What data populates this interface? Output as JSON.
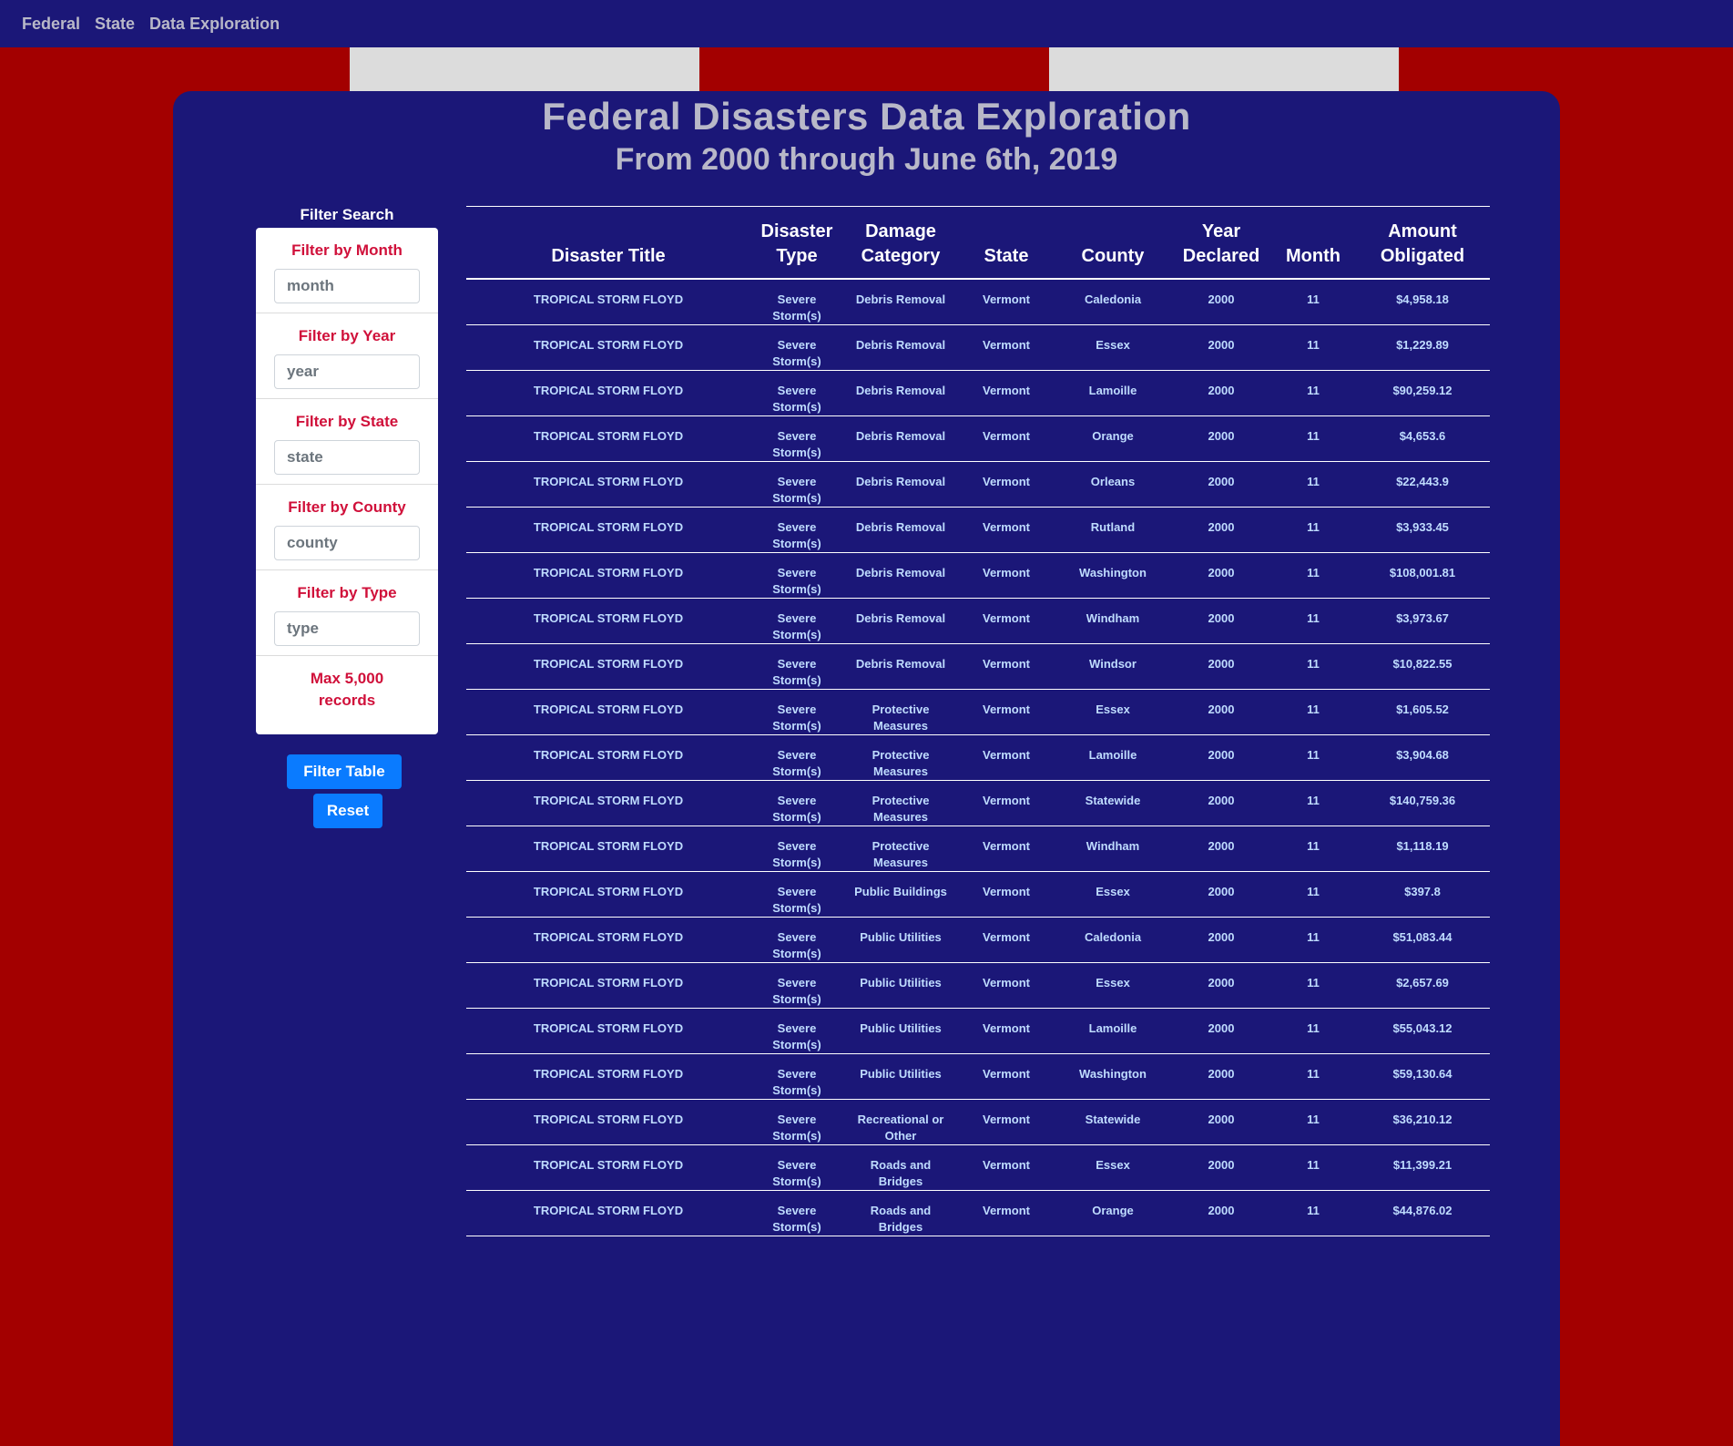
{
  "nav": {
    "links": [
      "Federal",
      "State",
      "Data Exploration"
    ]
  },
  "header": {
    "title": "Federal Disasters Data Exploration",
    "subtitle": "From 2000 through June 6th, 2019"
  },
  "filters": {
    "heading": "Filter Search",
    "month": {
      "label": "Filter by Month",
      "placeholder": "month",
      "value": ""
    },
    "year": {
      "label": "Filter by Year",
      "placeholder": "year",
      "value": ""
    },
    "state": {
      "label": "Filter by State",
      "placeholder": "state",
      "value": ""
    },
    "county": {
      "label": "Filter by County",
      "placeholder": "county",
      "value": ""
    },
    "type": {
      "label": "Filter by Type",
      "placeholder": "type",
      "value": ""
    },
    "note": "Max 5,000 records",
    "filter_button": "Filter Table",
    "reset_button": "Reset"
  },
  "table": {
    "columns": [
      "Disaster Title",
      "Disaster Type",
      "Damage Category",
      "State",
      "County",
      "Year Declared",
      "Month",
      "Amount Obligated"
    ],
    "rows": [
      [
        "TROPICAL STORM FLOYD",
        "Severe Storm(s)",
        "Debris Removal",
        "Vermont",
        "Caledonia",
        "2000",
        "11",
        "$4,958.18"
      ],
      [
        "TROPICAL STORM FLOYD",
        "Severe Storm(s)",
        "Debris Removal",
        "Vermont",
        "Essex",
        "2000",
        "11",
        "$1,229.89"
      ],
      [
        "TROPICAL STORM FLOYD",
        "Severe Storm(s)",
        "Debris Removal",
        "Vermont",
        "Lamoille",
        "2000",
        "11",
        "$90,259.12"
      ],
      [
        "TROPICAL STORM FLOYD",
        "Severe Storm(s)",
        "Debris Removal",
        "Vermont",
        "Orange",
        "2000",
        "11",
        "$4,653.6"
      ],
      [
        "TROPICAL STORM FLOYD",
        "Severe Storm(s)",
        "Debris Removal",
        "Vermont",
        "Orleans",
        "2000",
        "11",
        "$22,443.9"
      ],
      [
        "TROPICAL STORM FLOYD",
        "Severe Storm(s)",
        "Debris Removal",
        "Vermont",
        "Rutland",
        "2000",
        "11",
        "$3,933.45"
      ],
      [
        "TROPICAL STORM FLOYD",
        "Severe Storm(s)",
        "Debris Removal",
        "Vermont",
        "Washington",
        "2000",
        "11",
        "$108,001.81"
      ],
      [
        "TROPICAL STORM FLOYD",
        "Severe Storm(s)",
        "Debris Removal",
        "Vermont",
        "Windham",
        "2000",
        "11",
        "$3,973.67"
      ],
      [
        "TROPICAL STORM FLOYD",
        "Severe Storm(s)",
        "Debris Removal",
        "Vermont",
        "Windsor",
        "2000",
        "11",
        "$10,822.55"
      ],
      [
        "TROPICAL STORM FLOYD",
        "Severe Storm(s)",
        "Protective Measures",
        "Vermont",
        "Essex",
        "2000",
        "11",
        "$1,605.52"
      ],
      [
        "TROPICAL STORM FLOYD",
        "Severe Storm(s)",
        "Protective Measures",
        "Vermont",
        "Lamoille",
        "2000",
        "11",
        "$3,904.68"
      ],
      [
        "TROPICAL STORM FLOYD",
        "Severe Storm(s)",
        "Protective Measures",
        "Vermont",
        "Statewide",
        "2000",
        "11",
        "$140,759.36"
      ],
      [
        "TROPICAL STORM FLOYD",
        "Severe Storm(s)",
        "Protective Measures",
        "Vermont",
        "Windham",
        "2000",
        "11",
        "$1,118.19"
      ],
      [
        "TROPICAL STORM FLOYD",
        "Severe Storm(s)",
        "Public Buildings",
        "Vermont",
        "Essex",
        "2000",
        "11",
        "$397.8"
      ],
      [
        "TROPICAL STORM FLOYD",
        "Severe Storm(s)",
        "Public Utilities",
        "Vermont",
        "Caledonia",
        "2000",
        "11",
        "$51,083.44"
      ],
      [
        "TROPICAL STORM FLOYD",
        "Severe Storm(s)",
        "Public Utilities",
        "Vermont",
        "Essex",
        "2000",
        "11",
        "$2,657.69"
      ],
      [
        "TROPICAL STORM FLOYD",
        "Severe Storm(s)",
        "Public Utilities",
        "Vermont",
        "Lamoille",
        "2000",
        "11",
        "$55,043.12"
      ],
      [
        "TROPICAL STORM FLOYD",
        "Severe Storm(s)",
        "Public Utilities",
        "Vermont",
        "Washington",
        "2000",
        "11",
        "$59,130.64"
      ],
      [
        "TROPICAL STORM FLOYD",
        "Severe Storm(s)",
        "Recreational or Other",
        "Vermont",
        "Statewide",
        "2000",
        "11",
        "$36,210.12"
      ],
      [
        "TROPICAL STORM FLOYD",
        "Severe Storm(s)",
        "Roads and Bridges",
        "Vermont",
        "Essex",
        "2000",
        "11",
        "$11,399.21"
      ],
      [
        "TROPICAL STORM FLOYD",
        "Severe Storm(s)",
        "Roads and Bridges",
        "Vermont",
        "Orange",
        "2000",
        "11",
        "$44,876.02"
      ]
    ]
  },
  "colors": {
    "page_background": "#a30000",
    "panel_background": "#1b1778",
    "filter_label": "#d0103a",
    "button": "#0a7bff",
    "cell_text": "#bfdcff"
  }
}
